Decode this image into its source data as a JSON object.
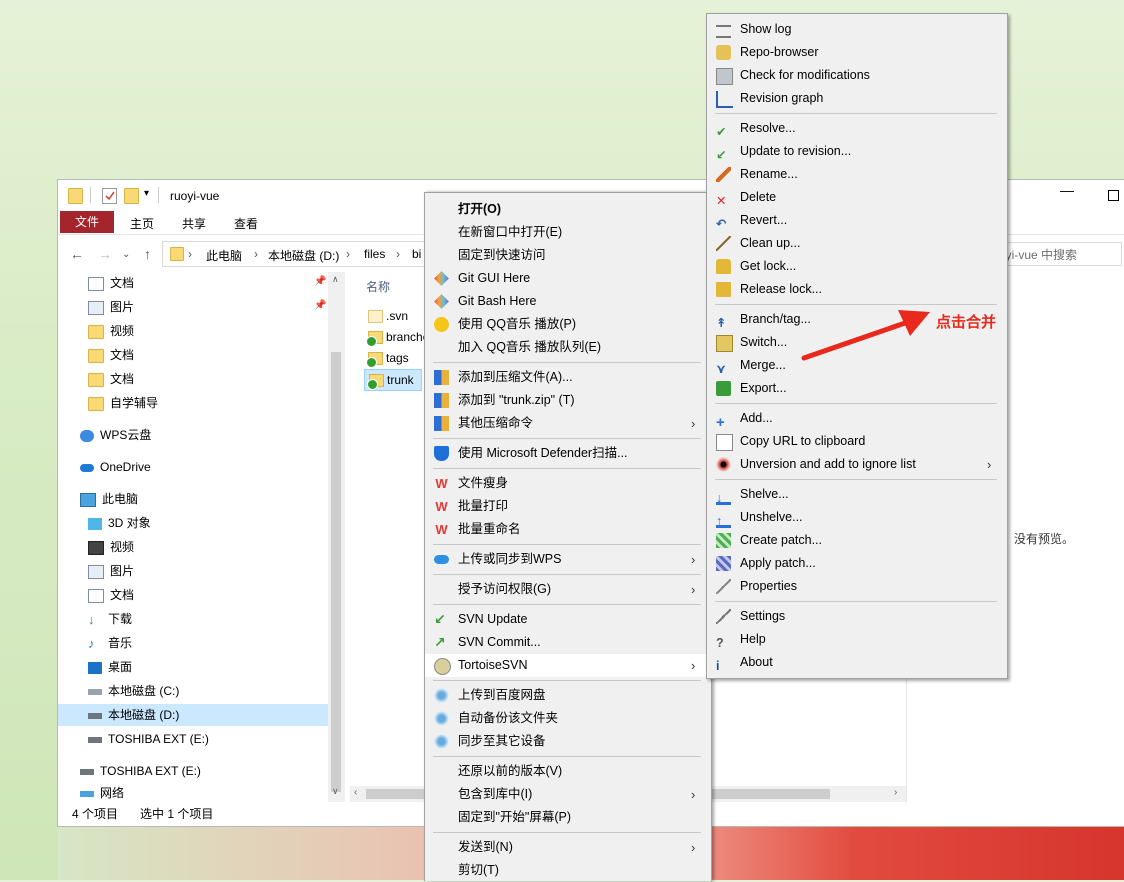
{
  "explorer": {
    "title": "ruoyi-vue",
    "ribbon": {
      "file": "文件",
      "home": "主页",
      "share": "共享",
      "view": "查看"
    },
    "breadcrumb": [
      "此电脑",
      "本地磁盘 (D:)",
      "files",
      "bi"
    ],
    "search_placeholder": "oyi-vue 中搜索",
    "nav_items": [
      {
        "label": "文档",
        "icon": "document-icon"
      },
      {
        "label": "图片",
        "icon": "picture-icon"
      },
      {
        "label": "视频",
        "icon": "folder-icon"
      },
      {
        "label": "文档",
        "icon": "folder-icon"
      },
      {
        "label": "文档",
        "icon": "folder-icon"
      },
      {
        "label": "自学辅导",
        "icon": "folder-icon"
      },
      {
        "label": "WPS云盘",
        "icon": "cloud-icon"
      },
      {
        "label": "OneDrive",
        "icon": "onedrive-icon"
      },
      {
        "label": "此电脑",
        "icon": "computer-icon"
      },
      {
        "label": "3D 对象",
        "icon": "cube-icon"
      },
      {
        "label": "视频",
        "icon": "video-icon"
      },
      {
        "label": "图片",
        "icon": "picture-icon"
      },
      {
        "label": "文档",
        "icon": "document-icon"
      },
      {
        "label": "下载",
        "icon": "download-icon"
      },
      {
        "label": "音乐",
        "icon": "music-icon"
      },
      {
        "label": "桌面",
        "icon": "desktop-icon"
      },
      {
        "label": "本地磁盘 (C:)",
        "icon": "drive-icon"
      },
      {
        "label": "本地磁盘 (D:)",
        "icon": "drive-icon"
      },
      {
        "label": "TOSHIBA EXT (E:)",
        "icon": "drive-icon"
      },
      {
        "label": "TOSHIBA EXT (E:)",
        "icon": "drive-icon"
      },
      {
        "label": "网络",
        "icon": "network-icon"
      }
    ],
    "column_name": "名称",
    "files": [
      ".svn",
      "branches",
      "tags",
      "trunk"
    ],
    "status_count": "4 个项目",
    "status_selected": "选中 1 个项目",
    "preview_text": "没有预览。"
  },
  "context_menu": {
    "items": [
      {
        "label": "打开(O)",
        "bold": true
      },
      {
        "label": "在新窗口中打开(E)"
      },
      {
        "label": "固定到快速访问"
      },
      {
        "label": "Git GUI Here",
        "icon": "git-icon"
      },
      {
        "label": "Git Bash Here",
        "icon": "git-icon"
      },
      {
        "label": "使用 QQ音乐 播放(P)",
        "icon": "qqmusic-icon"
      },
      {
        "label": "加入 QQ音乐 播放队列(E)"
      },
      {
        "label": "添加到压缩文件(A)...",
        "icon": "archive-icon"
      },
      {
        "label": "添加到 \"trunk.zip\" (T)",
        "icon": "archive-icon"
      },
      {
        "label": "其他压缩命令",
        "icon": "archive-icon",
        "submenu": true
      },
      {
        "label": "使用 Microsoft Defender扫描...",
        "icon": "shield-icon"
      },
      {
        "label": "文件瘦身",
        "icon": "wps-icon"
      },
      {
        "label": "批量打印",
        "icon": "wps-icon"
      },
      {
        "label": "批量重命名",
        "icon": "wps-icon"
      },
      {
        "label": "上传或同步到WPS",
        "icon": "cloud-icon",
        "submenu": true
      },
      {
        "label": "授予访问权限(G)",
        "submenu": true
      },
      {
        "label": "SVN Update",
        "icon": "svn-update-icon"
      },
      {
        "label": "SVN Commit...",
        "icon": "svn-commit-icon"
      },
      {
        "label": "TortoiseSVN",
        "icon": "tortoisesvn-icon",
        "submenu": true
      },
      {
        "label": "上传到百度网盘",
        "icon": "baidu-icon"
      },
      {
        "label": "自动备份该文件夹",
        "icon": "baidu-icon"
      },
      {
        "label": "同步至其它设备",
        "icon": "baidu-icon"
      },
      {
        "label": "还原以前的版本(V)"
      },
      {
        "label": "包含到库中(I)",
        "submenu": true
      },
      {
        "label": "固定到\"开始\"屏幕(P)"
      },
      {
        "label": "发送到(N)",
        "submenu": true
      },
      {
        "label": "剪切(T)"
      }
    ]
  },
  "svn_menu": {
    "items": [
      {
        "label": "Show log",
        "icon": "log-icon"
      },
      {
        "label": "Repo-browser",
        "icon": "repo-icon"
      },
      {
        "label": "Check for modifications",
        "icon": "modifications-icon"
      },
      {
        "label": "Revision graph",
        "icon": "graph-icon"
      },
      {
        "label": "Resolve...",
        "icon": "resolve-icon"
      },
      {
        "label": "Update to revision...",
        "icon": "update-icon"
      },
      {
        "label": "Rename...",
        "icon": "rename-icon"
      },
      {
        "label": "Delete",
        "icon": "delete-icon"
      },
      {
        "label": "Revert...",
        "icon": "revert-icon"
      },
      {
        "label": "Clean up...",
        "icon": "cleanup-icon"
      },
      {
        "label": "Get lock...",
        "icon": "lock-icon"
      },
      {
        "label": "Release lock...",
        "icon": "unlock-icon"
      },
      {
        "label": "Branch/tag...",
        "icon": "branch-icon"
      },
      {
        "label": "Switch...",
        "icon": "switch-icon"
      },
      {
        "label": "Merge...",
        "icon": "merge-icon"
      },
      {
        "label": "Export...",
        "icon": "export-icon"
      },
      {
        "label": "Add...",
        "icon": "add-icon"
      },
      {
        "label": "Copy URL to clipboard",
        "icon": "copy-icon"
      },
      {
        "label": "Unversion and add to ignore list",
        "icon": "ignore-icon",
        "submenu": true
      },
      {
        "label": "Shelve...",
        "icon": "shelve-icon"
      },
      {
        "label": "Unshelve...",
        "icon": "unshelve-icon"
      },
      {
        "label": "Create patch...",
        "icon": "patch-icon"
      },
      {
        "label": "Apply patch...",
        "icon": "apply-patch-icon"
      },
      {
        "label": "Properties",
        "icon": "properties-icon"
      },
      {
        "label": "Settings",
        "icon": "settings-icon"
      },
      {
        "label": "Help",
        "icon": "help-icon"
      },
      {
        "label": "About",
        "icon": "about-icon"
      }
    ]
  },
  "annotation": "点击合并",
  "colors": {
    "accent": "#a4262c",
    "annotation": "#e8291c",
    "selection": "#cce8ff"
  }
}
